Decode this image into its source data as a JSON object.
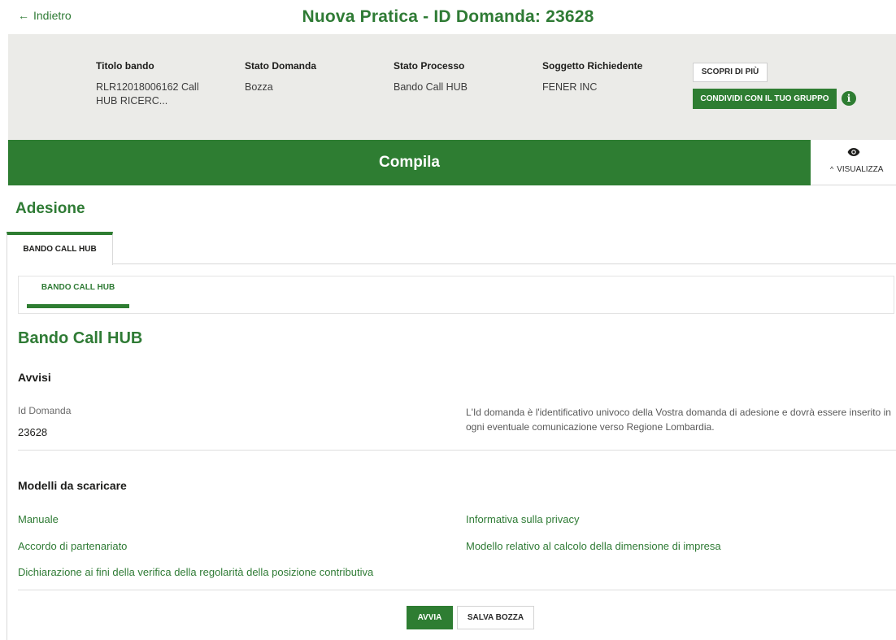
{
  "header": {
    "back_label": "Indietro",
    "title": "Nuova Pratica - ID Domanda: 23628"
  },
  "summary": {
    "titolo_bando": {
      "label": "Titolo bando",
      "value": "RLR12018006162 Call HUB RICERC..."
    },
    "stato_domanda": {
      "label": "Stato Domanda",
      "value": "Bozza"
    },
    "stato_processo": {
      "label": "Stato Processo",
      "value": "Bando Call HUB"
    },
    "soggetto": {
      "label": "Soggetto Richiedente",
      "value": "FENER INC"
    },
    "scopri_label": "SCOPRI DI PIÙ",
    "condividi_label": "CONDIVIDI CON IL TUO GRUPPO",
    "info_glyph": "i"
  },
  "compila": {
    "label": "Compila",
    "visualizza_label": "VISUALIZZA"
  },
  "section": {
    "title": "Adesione",
    "tab_label": "BANDO CALL HUB",
    "subtab_label": "BANDO CALL HUB"
  },
  "form": {
    "heading": "Bando Call HUB",
    "avvisi_title": "Avvisi",
    "id_label": "Id Domanda",
    "id_value": "23628",
    "id_note": "L'Id domanda è l'identificativo univoco della Vostra domanda di adesione e dovrà essere inserito in ogni eventuale comunicazione verso Regione Lombardia.",
    "modelli_title": "Modelli da scaricare",
    "links": {
      "manuale": "Manuale",
      "privacy": "Informativa sulla privacy",
      "accordo": "Accordo di partenariato",
      "dimensione": "Modello relativo al calcolo della dimensione di impresa",
      "dichiarazione": "Dichiarazione ai fini della verifica della regolarità della posizione contributiva"
    }
  },
  "actions": {
    "avvia_label": "AVVIA",
    "salva_label": "SALVA BOZZA"
  },
  "colors": {
    "accent": "#2e7d32",
    "summary_bg": "#ebebe8"
  },
  "icons": {
    "back": "arrow-left-icon",
    "info": "info-icon",
    "eye": "eye-icon",
    "chevron": "chevron-up-icon"
  }
}
